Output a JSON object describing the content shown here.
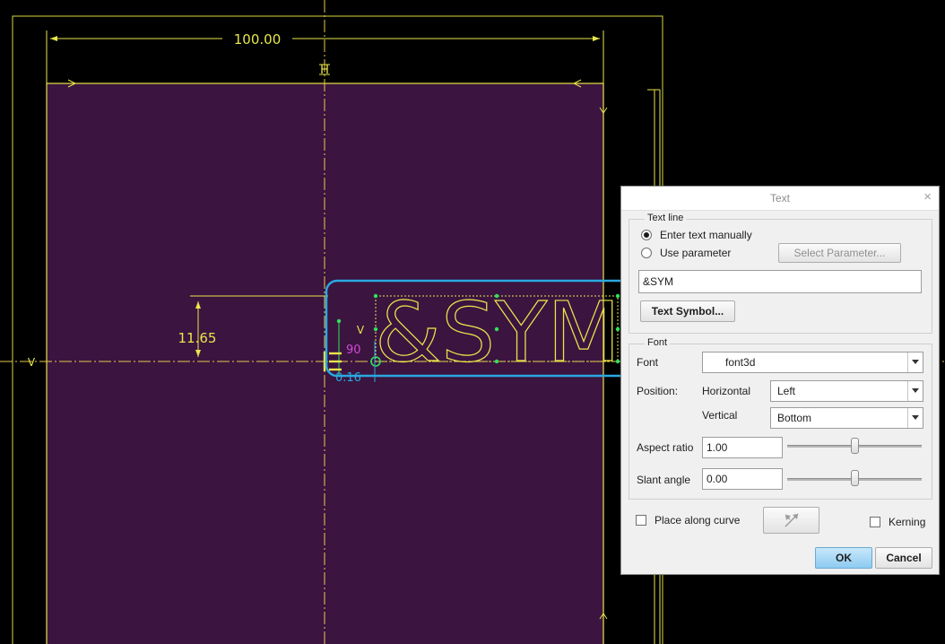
{
  "sketch": {
    "dimension_width": "100.00",
    "dimension_height": "11.65",
    "sketch_text": "&SYM",
    "angle_dim_1": "90",
    "angle_dim_2": "0.16",
    "constraint_v_1": "V",
    "constraint_v_2": "V",
    "constraint_h": "H"
  },
  "dialog": {
    "title": "Text",
    "close_glyph": "×",
    "text_line": {
      "group_label": "Text line",
      "option_manual": "Enter text manually",
      "option_parameter": "Use parameter",
      "selected": "manual",
      "select_parameter_button": "Select Parameter...",
      "text_value": "&SYM",
      "text_symbol_button": "Text Symbol..."
    },
    "font": {
      "group_label": "Font",
      "font_label": "Font",
      "font_value": "font3d",
      "position_label": "Position:",
      "horizontal_label": "Horizontal",
      "horizontal_value": "Left",
      "vertical_label": "Vertical",
      "vertical_value": "Bottom",
      "aspect_label": "Aspect ratio",
      "aspect_value": "1.00",
      "slant_label": "Slant angle",
      "slant_value": "0.00"
    },
    "place_along_curve": "Place along curve",
    "kerning": "Kerning",
    "ok": "OK",
    "cancel": "Cancel"
  },
  "colors": {
    "background": "#000000",
    "surface": "#3b1440",
    "sketch_line": "#e8e64a",
    "highlight": "#2aa8df",
    "point": "#2ee35a",
    "dim_magenta": "#d24bd6"
  }
}
